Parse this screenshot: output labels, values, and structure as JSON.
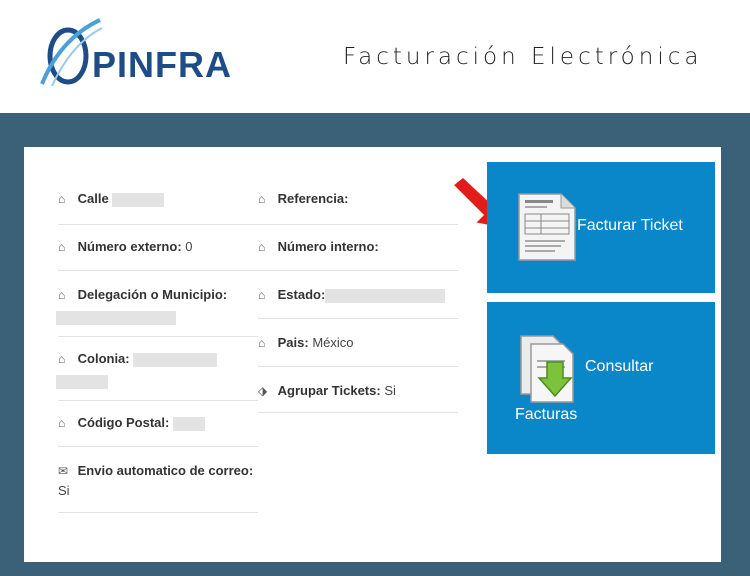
{
  "header": {
    "logo_text": "PINFRA",
    "title": "Facturación Electrónica"
  },
  "left_fields": [
    {
      "label": "Calle",
      "value": ""
    },
    {
      "label": "Número externo:",
      "value": " 0"
    },
    {
      "label": "Delegación o Municipio:",
      "value": ""
    },
    {
      "label": "Colonia:",
      "value": ""
    },
    {
      "label": "Código Postal:",
      "value": ""
    },
    {
      "label": "Envio automatico de correo:",
      "value": "Si"
    }
  ],
  "right_fields": [
    {
      "label": "Referencia:",
      "value": ""
    },
    {
      "label": "Número interno:",
      "value": ""
    },
    {
      "label": "Estado:",
      "value": ""
    },
    {
      "label": "Pais:",
      "value": " México"
    },
    {
      "label": "Agrupar Tickets:",
      "value": " Si"
    }
  ],
  "tiles": {
    "facturar_label": "Facturar Ticket",
    "consultar_label_1": "Consultar",
    "consultar_label_2": "Facturas"
  },
  "colors": {
    "band": "#3a6177",
    "tile": "#0a87c8",
    "logo": "#1d4c86",
    "arrow": "#e21b1b"
  },
  "icons": {
    "field": "home-icon",
    "email": "envelope-icon",
    "tag": "tag-icon"
  }
}
